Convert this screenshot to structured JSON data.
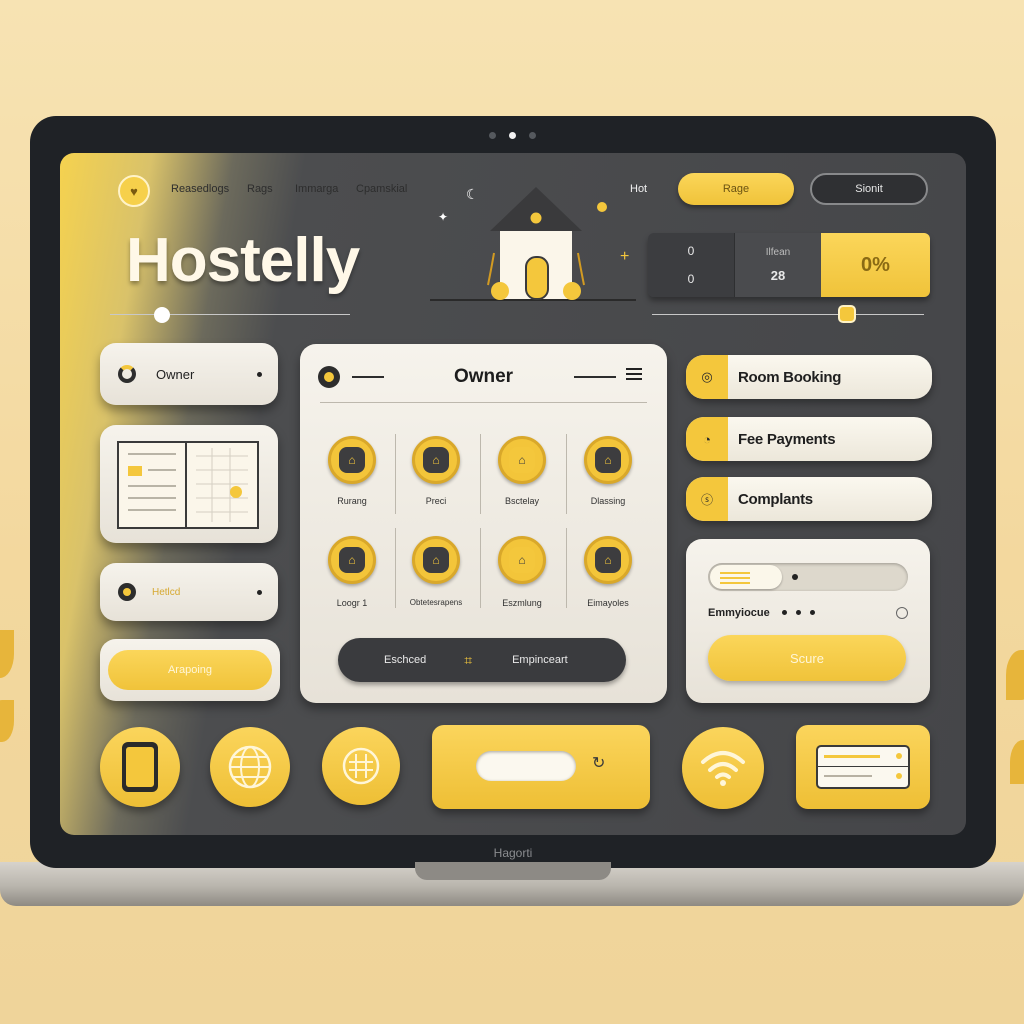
{
  "bezel": {
    "brand": "Hagorti"
  },
  "nav": {
    "links": [
      "Reasedlogs",
      "Rags",
      "Immarga",
      "Cpamskial"
    ],
    "hot": "Hot",
    "primary_button": "Rage",
    "secondary_button": "Sionit"
  },
  "brand": {
    "title": "Hostelly"
  },
  "stats": {
    "col1_top": "0",
    "col1_bottom": "0",
    "col2_label": "Ilfean",
    "col2_value": "28",
    "col3_value": "0%"
  },
  "left": {
    "owner_label": "Owner",
    "small_label": "Hetlcd",
    "yellow_button": "Arapoing"
  },
  "owner_panel": {
    "title": "Owner",
    "grid": [
      "Rurang",
      "Preci",
      "Bsctelay",
      "Dlassing",
      "Loogr 1",
      "Obtetesrapens",
      "Eszmlung",
      "Eimayoles"
    ],
    "footer_left": "Eschced",
    "footer_right": "Empinceart"
  },
  "right": {
    "room_booking": "Room Booking",
    "fee_payments": "Fee Payments",
    "complaints": "Complants",
    "employee_label": "Emmyiocue",
    "score_button": "Scure"
  },
  "colors": {
    "accent": "#f4c73c",
    "dark": "#45464a",
    "card": "#f1eee6"
  }
}
